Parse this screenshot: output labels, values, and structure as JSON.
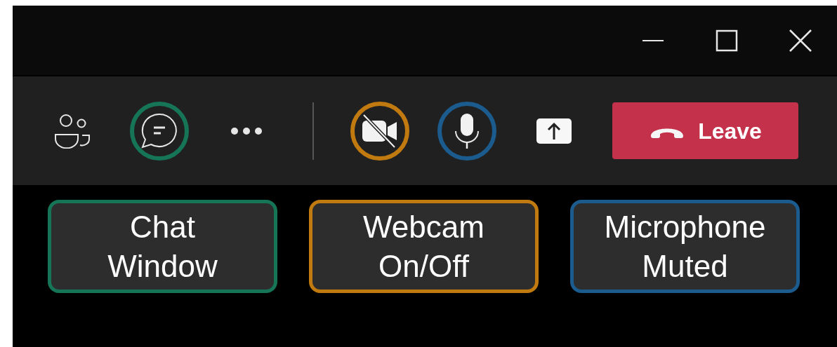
{
  "window_controls": [
    {
      "kind": "minimize"
    },
    {
      "kind": "maximize"
    },
    {
      "kind": "close"
    }
  ],
  "toolbar": [
    {
      "kind": "people"
    },
    {
      "kind": "chat",
      "color": "#167457"
    },
    {
      "kind": "more"
    },
    {
      "kind": "divider"
    },
    {
      "kind": "camera",
      "on": false,
      "color": "#c17a0f"
    },
    {
      "kind": "mic",
      "color": "#1b5b8d"
    },
    {
      "kind": "share"
    },
    {
      "kind": "leave",
      "label": "Leave"
    }
  ],
  "callouts": [
    {
      "lines": [
        "Chat",
        "Window"
      ],
      "color": "#167457"
    },
    {
      "lines": [
        "Webcam",
        "On/Off"
      ],
      "color": "#c17a0f"
    },
    {
      "lines": [
        "Microphone",
        "Muted"
      ],
      "color": "#1b5b8d"
    }
  ]
}
